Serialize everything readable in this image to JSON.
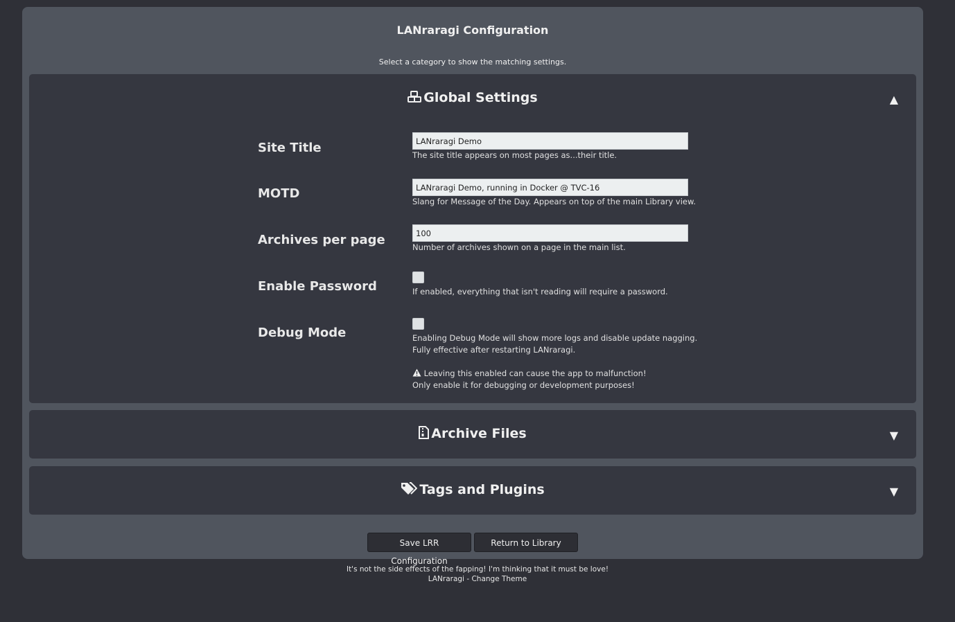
{
  "header": {
    "title": "LANraragi Configuration",
    "subtitle": "Select a category to show the matching settings."
  },
  "sections": {
    "global": {
      "title": "Global Settings",
      "icon": "cubes-icon",
      "chevron": "▲",
      "expanded": true
    },
    "archive": {
      "title": "Archive Files",
      "icon": "file-archive-icon",
      "chevron": "▼",
      "expanded": false
    },
    "tags": {
      "title": "Tags and Plugins",
      "icon": "tags-icon",
      "chevron": "▼",
      "expanded": false
    }
  },
  "settings": {
    "site_title": {
      "label": "Site Title",
      "value": "LANraragi Demo",
      "help": "The site title appears on most pages as...their title."
    },
    "motd": {
      "label": "MOTD",
      "value": "LANraragi Demo, running in Docker @ TVC-16",
      "help": "Slang for Message of the Day. Appears on top of the main Library view."
    },
    "archives_per_page": {
      "label": "Archives per page",
      "value": "100",
      "help": "Number of archives shown on a page in the main list."
    },
    "enable_password": {
      "label": "Enable Password",
      "checked": false,
      "help": "If enabled, everything that isn't reading will require a password."
    },
    "debug_mode": {
      "label": "Debug Mode",
      "checked": false,
      "help_line1": "Enabling Debug Mode will show more logs and disable update nagging.",
      "help_line2": "Fully effective after restarting LANraragi.",
      "warning_line1": "Leaving this enabled can cause the app to malfunction!",
      "warning_line2": "Only enable it for debugging or development purposes!"
    }
  },
  "buttons": {
    "save": "Save LRR Configuration",
    "return": "Return to Library"
  },
  "footer": {
    "motd_line": "It's not the side effects of the fapping! I'm thinking that it must be love!",
    "app_link": "LANraragi",
    "separator": " - ",
    "theme_link": "Change Theme"
  },
  "colors": {
    "background": "#2f3037",
    "panel": "#50555e",
    "section": "#353740",
    "input": "#eceff0"
  }
}
